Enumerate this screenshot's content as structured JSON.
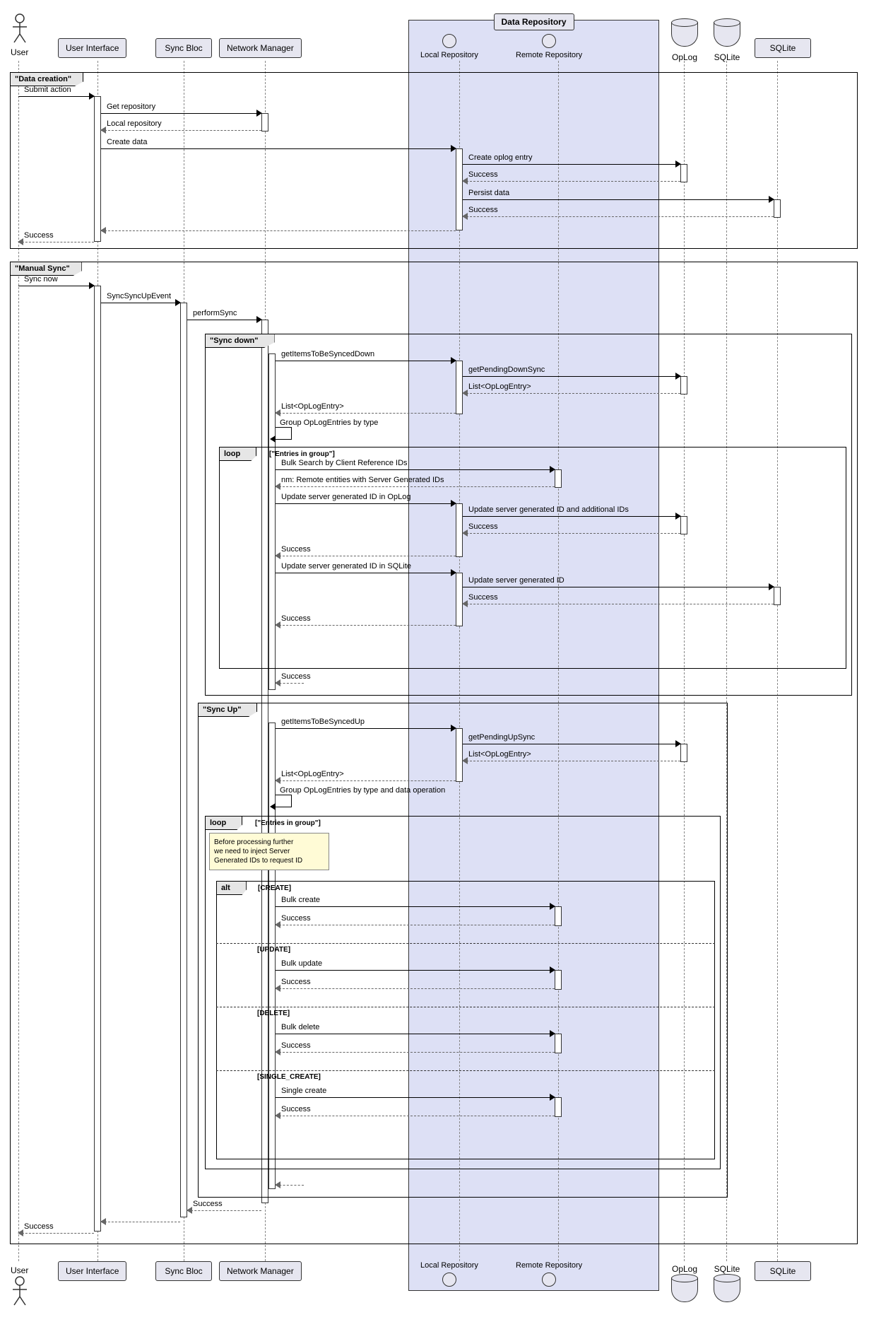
{
  "participants": {
    "user": "User",
    "ui": "User Interface",
    "sync": "Sync Bloc",
    "nm": "Network Manager",
    "repo_group": "Data Repository",
    "local": "Local Repository",
    "remote": "Remote Repository",
    "oplog": "OpLog",
    "sqlite1": "SQLite",
    "sqlite2": "SQLite"
  },
  "frames": {
    "data_creation": "\"Data creation\"",
    "manual_sync": "\"Manual Sync\"",
    "sync_down": "\"Sync down\"",
    "sync_up": "\"Sync Up\"",
    "loop": "loop",
    "loop_guard": "[\"Entries in group\"]",
    "alt": "alt",
    "alt_create": "[CREATE]",
    "alt_update": "[UPDATE]",
    "alt_delete": "[DELETE]",
    "alt_single": "[SINGLE_CREATE]"
  },
  "msgs": {
    "submit": "Submit action",
    "get_repo": "Get repository",
    "local_repo": "Local repository",
    "create_data": "Create data",
    "create_oplog": "Create oplog entry",
    "success": "Success",
    "persist": "Persist data",
    "sync_now": "Sync now",
    "sync_event": "SyncSyncUpEvent",
    "perform_sync": "performSync",
    "get_down": "getItemsToBeSyncedDown",
    "pending_down": "getPendingDownSync",
    "list_oplog": "List<OpLogEntry>",
    "group_type": "Group OpLogEntries by type",
    "bulk_search": "Bulk Search by Client Reference IDs",
    "nm_remote": "nm: Remote entities with Server Generated IDs",
    "update_oplog": "Update server generated ID in OpLog",
    "update_ids": "Update server generated ID and additional IDs",
    "update_sqlite": "Update server generated ID in SQLite",
    "update_id": "Update server generated ID",
    "get_up": "getItemsToBeSyncedUp",
    "pending_up": "getPendingUpSync",
    "group_op": "Group OpLogEntries by type and data operation",
    "bulk_create": "Bulk create",
    "bulk_update": "Bulk update",
    "bulk_delete": "Bulk delete",
    "single_create": "Single create"
  },
  "note": "Before processing further\nwe need to inject Server\nGenerated IDs to request ID"
}
